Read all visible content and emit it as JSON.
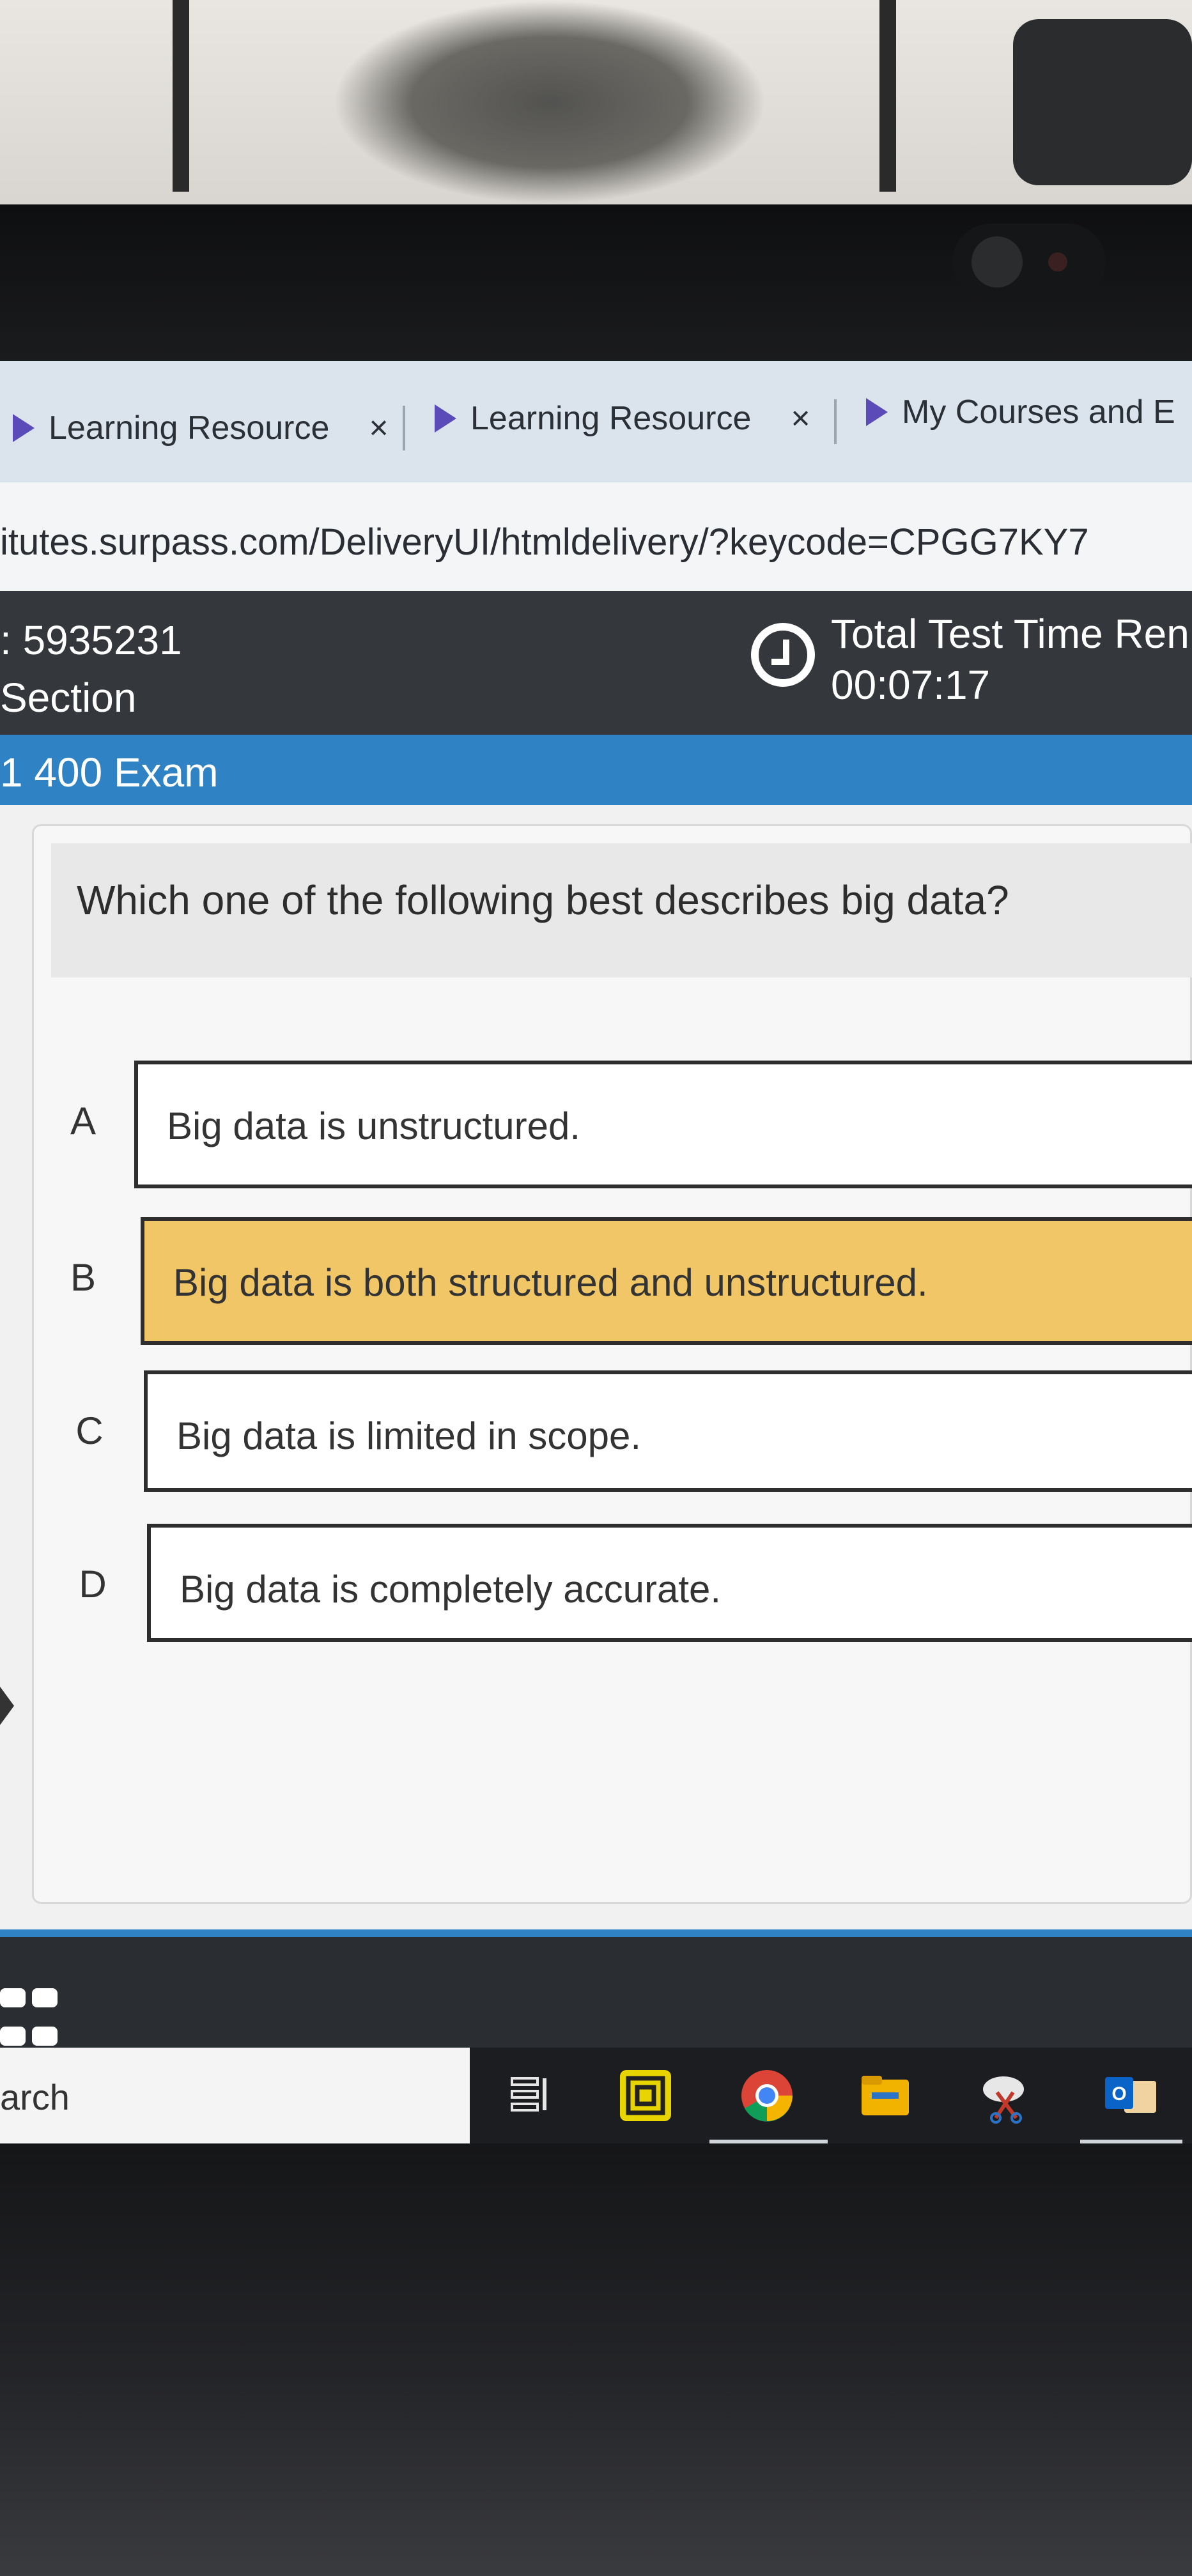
{
  "browser": {
    "tabs": [
      {
        "label": "Learning Resource",
        "close": "×"
      },
      {
        "label": "Learning Resource",
        "close": "×"
      },
      {
        "label": "My Courses and E"
      }
    ],
    "url": "itutes.surpass.com/DeliveryUI/htmldelivery/?keycode=CPGG7KY7"
  },
  "exam_header": {
    "candidate_id": ": 5935231",
    "section": "Section",
    "timer_label": "Total Test Time Ren",
    "timer_value": "00:07:17",
    "exam_title": "1 400 Exam"
  },
  "question": {
    "text": "Which one of the following best describes big data?",
    "options": [
      {
        "letter": "A",
        "text": "Big data is unstructured.",
        "selected": false
      },
      {
        "letter": "B",
        "text": "Big data is both structured and unstructured.",
        "selected": true
      },
      {
        "letter": "C",
        "text": "Big data is limited in scope.",
        "selected": false
      },
      {
        "letter": "D",
        "text": "Big data is completely accurate.",
        "selected": false
      }
    ]
  },
  "taskbar": {
    "search_text": "arch",
    "apps": [
      "task-view-icon",
      "gallery-app-icon",
      "chrome-icon",
      "file-explorer-icon",
      "snipping-tool-icon",
      "outlook-icon"
    ]
  },
  "colors": {
    "header_bg": "#34383d",
    "exam_bar": "#2f82c3",
    "selected_option": "#f1c666",
    "tab_icon": "#5a4bb8"
  }
}
